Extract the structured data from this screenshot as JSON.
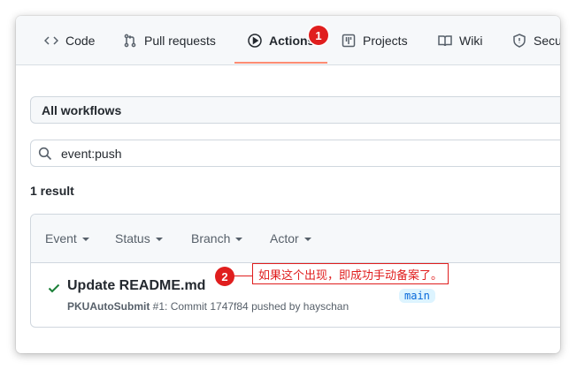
{
  "tabs": [
    {
      "label": "Code",
      "icon": "code-icon"
    },
    {
      "label": "Pull requests",
      "icon": "pull-request-icon"
    },
    {
      "label": "Actions",
      "icon": "play-icon",
      "active": true
    },
    {
      "label": "Projects",
      "icon": "project-table-icon"
    },
    {
      "label": "Wiki",
      "icon": "book-icon"
    },
    {
      "label": "Secu",
      "icon": "shield-icon"
    }
  ],
  "annotations": {
    "marker1": "1",
    "marker2": "2",
    "callout_text": "如果这个出现，即成功手动备案了。",
    "color": "#e01e1e"
  },
  "workflow_select": {
    "value": "All workflows"
  },
  "search": {
    "value": "event:push",
    "icon": "search-icon"
  },
  "result_count": "1 result",
  "filters": [
    "Event",
    "Status",
    "Branch",
    "Actor"
  ],
  "run": {
    "status_icon": "check-icon",
    "title": "Update README.md",
    "workflow": "PKUAutoSubmit",
    "details": "#1: Commit 1747f84 pushed by hayschan",
    "branch": "main"
  },
  "colors": {
    "accent_underline": "#fd8c73",
    "success": "#1a7f37",
    "branch_text": "#0969da",
    "branch_bg": "#ddf4ff"
  }
}
